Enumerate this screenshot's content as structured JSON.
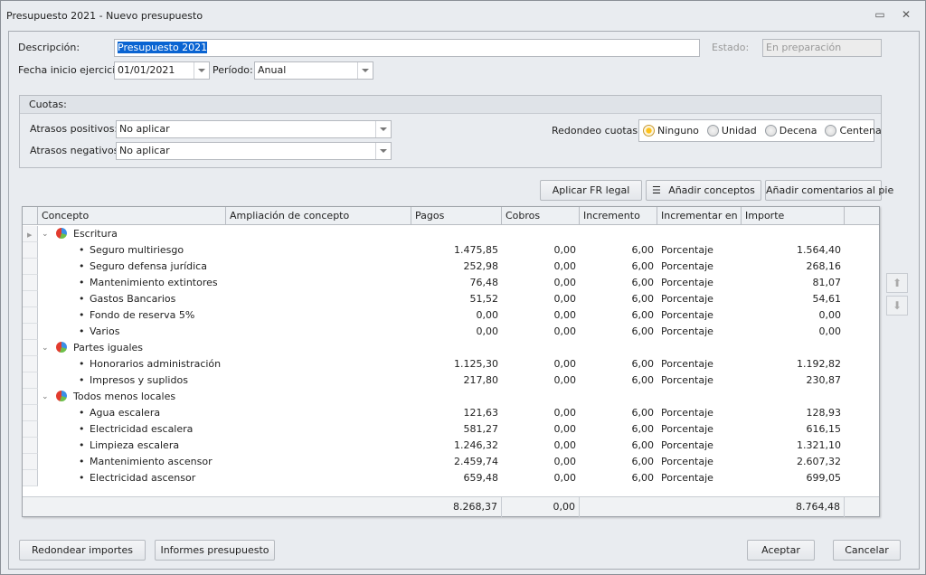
{
  "window": {
    "title": "Presupuesto 2021 - Nuevo presupuesto"
  },
  "form": {
    "descripcion_label": "Descripción:",
    "descripcion_value": "Presupuesto 2021",
    "estado_label": "Estado:",
    "estado_value": "En preparación",
    "fecha_label": "Fecha inicio ejercicio:",
    "fecha_value": "01/01/2021",
    "periodo_label": "Período:",
    "periodo_value": "Anual"
  },
  "cuotas": {
    "title": "Cuotas:",
    "positivos_label": "Atrasos positivos:",
    "positivos_value": "No aplicar",
    "negativos_label": "Atrasos negativos:",
    "negativos_value": "No aplicar",
    "redondeo_label": "Redondeo cuotas:",
    "options": [
      "Ninguno",
      "Unidad",
      "Decena",
      "Centena"
    ],
    "selected": "Ninguno"
  },
  "toolbar": {
    "aplicar": "Aplicar FR legal",
    "anadir_conceptos": "Añadir conceptos",
    "anadir_comentarios": "Añadir comentarios al pie"
  },
  "grid": {
    "columns": [
      "Concepto",
      "Ampliación de concepto",
      "Pagos",
      "Cobros",
      "Incremento",
      "Incrementar en",
      "Importe"
    ],
    "rows": [
      {
        "group": true,
        "concepto": "Escritura"
      },
      {
        "concepto": "Seguro multiriesgo",
        "pagos": "1.475,85",
        "cobros": "0,00",
        "inc": "6,00",
        "en": "Porcentaje",
        "importe": "1.564,40"
      },
      {
        "concepto": "Seguro defensa jurídica",
        "pagos": "252,98",
        "cobros": "0,00",
        "inc": "6,00",
        "en": "Porcentaje",
        "importe": "268,16"
      },
      {
        "concepto": "Mantenimiento extintores",
        "pagos": "76,48",
        "cobros": "0,00",
        "inc": "6,00",
        "en": "Porcentaje",
        "importe": "81,07"
      },
      {
        "concepto": "Gastos Bancarios",
        "pagos": "51,52",
        "cobros": "0,00",
        "inc": "6,00",
        "en": "Porcentaje",
        "importe": "54,61"
      },
      {
        "concepto": "Fondo de reserva 5%",
        "pagos": "0,00",
        "cobros": "0,00",
        "inc": "6,00",
        "en": "Porcentaje",
        "importe": "0,00"
      },
      {
        "concepto": "Varios",
        "pagos": "0,00",
        "cobros": "0,00",
        "inc": "6,00",
        "en": "Porcentaje",
        "importe": "0,00"
      },
      {
        "group": true,
        "concepto": "Partes iguales"
      },
      {
        "concepto": "Honorarios administración",
        "pagos": "1.125,30",
        "cobros": "0,00",
        "inc": "6,00",
        "en": "Porcentaje",
        "importe": "1.192,82"
      },
      {
        "concepto": "Impresos y suplidos",
        "pagos": "217,80",
        "cobros": "0,00",
        "inc": "6,00",
        "en": "Porcentaje",
        "importe": "230,87"
      },
      {
        "group": true,
        "concepto": "Todos menos locales"
      },
      {
        "concepto": "Agua escalera",
        "pagos": "121,63",
        "cobros": "0,00",
        "inc": "6,00",
        "en": "Porcentaje",
        "importe": "128,93"
      },
      {
        "concepto": "Electricidad escalera",
        "pagos": "581,27",
        "cobros": "0,00",
        "inc": "6,00",
        "en": "Porcentaje",
        "importe": "616,15"
      },
      {
        "concepto": "Limpieza escalera",
        "pagos": "1.246,32",
        "cobros": "0,00",
        "inc": "6,00",
        "en": "Porcentaje",
        "importe": "1.321,10"
      },
      {
        "concepto": "Mantenimiento ascensor",
        "pagos": "2.459,74",
        "cobros": "0,00",
        "inc": "6,00",
        "en": "Porcentaje",
        "importe": "2.607,32"
      },
      {
        "concepto": "Electricidad ascensor",
        "pagos": "659,48",
        "cobros": "0,00",
        "inc": "6,00",
        "en": "Porcentaje",
        "importe": "699,05"
      }
    ],
    "totals": {
      "pagos": "8.268,37",
      "cobros": "0,00",
      "importe": "8.764,48"
    }
  },
  "footer": {
    "redondear": "Redondear importes",
    "informes": "Informes presupuesto",
    "aceptar": "Aceptar",
    "cancelar": "Cancelar"
  }
}
